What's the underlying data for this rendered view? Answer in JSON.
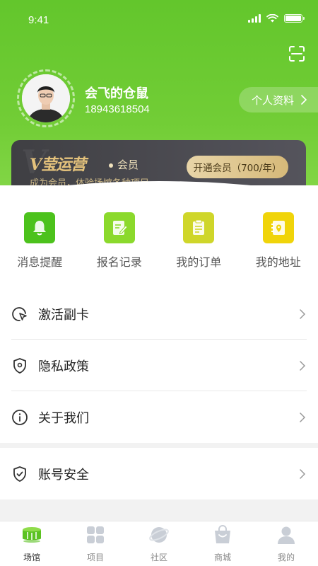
{
  "status_bar": {
    "time": "9:41"
  },
  "profile": {
    "name": "会飞的仓鼠",
    "phone": "18943618504",
    "profile_button": "个人资料"
  },
  "vip": {
    "logo_text": "V莹运营",
    "tag": "会员",
    "description": "成为会员，体验场馆各种项目",
    "button": "开通会员（700/年）"
  },
  "quick_actions": [
    {
      "label": "消息提醒",
      "icon": "bell-icon",
      "color": "#4cc21c"
    },
    {
      "label": "报名记录",
      "icon": "signup-record-icon",
      "color": "#8bd92c"
    },
    {
      "label": "我的订单",
      "icon": "order-icon",
      "color": "#cfd62a"
    },
    {
      "label": "我的地址",
      "icon": "address-icon",
      "color": "#f0d40a"
    }
  ],
  "menu": {
    "activate_card": "激活副卡",
    "privacy_policy": "隐私政策",
    "about_us": "关于我们",
    "account_security": "账号安全"
  },
  "tabbar": [
    {
      "label": "场馆",
      "icon": "stadium-icon",
      "active": true
    },
    {
      "label": "项目",
      "icon": "grid-icon",
      "active": false
    },
    {
      "label": "社区",
      "icon": "planet-icon",
      "active": false
    },
    {
      "label": "商城",
      "icon": "shopping-bag-icon",
      "active": false
    },
    {
      "label": "我的",
      "icon": "user-icon",
      "active": false
    }
  ],
  "colors": {
    "brand_green": "#63c62c",
    "vip_gold": "#d6b979",
    "vip_dark": "#3f3f43"
  }
}
